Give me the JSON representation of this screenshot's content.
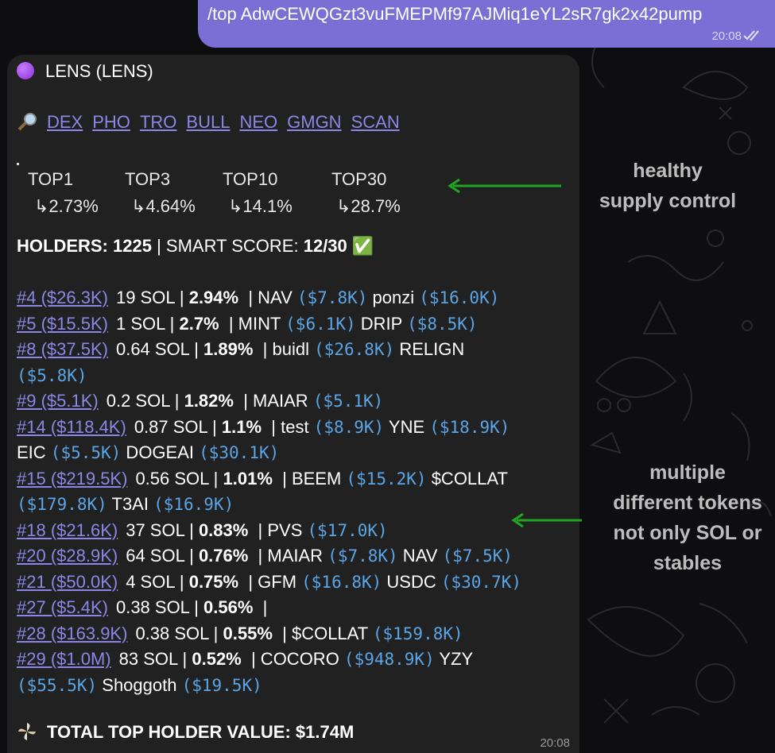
{
  "outgoing": {
    "text": "/top AdwCEWQGzt3vuFMEPMf97AJMiq1eYL2sR7gk2x42pump",
    "time": "20:08"
  },
  "message": {
    "title": "LENS (LENS)",
    "links": [
      "DEX",
      "PHO",
      "TRO",
      "BULL",
      "NEO",
      "GMGN",
      "SCAN"
    ],
    "top": [
      {
        "label": "TOP1",
        "value": "↳2.73%"
      },
      {
        "label": "TOP3",
        "value": "↳4.64%"
      },
      {
        "label": "TOP10",
        "value": "↳14.1%"
      },
      {
        "label": "TOP30",
        "value": "↳28.7%"
      }
    ],
    "holders_label": "HOLDERS:",
    "holders_value": "1225",
    "smart_label": "SMART SCORE:",
    "smart_value": "12/30",
    "check": "✅",
    "rows": [
      [
        {
          "t": "rank",
          "v": "#4 ($26.3K)"
        },
        {
          "t": "txt",
          "v": "19 SOL | "
        },
        {
          "t": "b",
          "v": "2.94%"
        },
        {
          "t": "txt",
          "v": "  | NAV "
        },
        {
          "t": "m",
          "v": "($7.8K)"
        },
        {
          "t": "txt",
          "v": " ponzi "
        },
        {
          "t": "m",
          "v": "($16.0K)"
        }
      ],
      [
        {
          "t": "rank",
          "v": "#5 ($15.5K)"
        },
        {
          "t": "txt",
          "v": "1 SOL | "
        },
        {
          "t": "b",
          "v": "2.7%"
        },
        {
          "t": "txt",
          "v": "  | MINT "
        },
        {
          "t": "m",
          "v": "($6.1K)"
        },
        {
          "t": "txt",
          "v": " DRIP "
        },
        {
          "t": "m",
          "v": "($8.5K)"
        }
      ],
      [
        {
          "t": "rank",
          "v": "#8 ($37.5K)"
        },
        {
          "t": "txt",
          "v": "0.64 SOL | "
        },
        {
          "t": "b",
          "v": "1.89%"
        },
        {
          "t": "txt",
          "v": "  | buidl "
        },
        {
          "t": "m",
          "v": "($26.8K)"
        },
        {
          "t": "txt",
          "v": " RELIGN"
        }
      ],
      [
        {
          "t": "m",
          "v": "($5.8K)"
        }
      ],
      [
        {
          "t": "rank",
          "v": "#9 ($5.1K)"
        },
        {
          "t": "txt",
          "v": "0.2 SOL | "
        },
        {
          "t": "b",
          "v": "1.82%"
        },
        {
          "t": "txt",
          "v": "  | MAIAR "
        },
        {
          "t": "m",
          "v": "($5.1K)"
        }
      ],
      [
        {
          "t": "rank",
          "v": "#14 ($118.4K)"
        },
        {
          "t": "txt",
          "v": "0.87 SOL | "
        },
        {
          "t": "b",
          "v": "1.1%"
        },
        {
          "t": "txt",
          "v": "  | test "
        },
        {
          "t": "m",
          "v": "($8.9K)"
        },
        {
          "t": "txt",
          "v": " YNE "
        },
        {
          "t": "m",
          "v": "($18.9K)"
        }
      ],
      [
        {
          "t": "txt",
          "v": "EIC "
        },
        {
          "t": "m",
          "v": "($5.5K)"
        },
        {
          "t": "txt",
          "v": " DOGEAI "
        },
        {
          "t": "m",
          "v": "($30.1K)"
        }
      ],
      [
        {
          "t": "rank",
          "v": "#15 ($219.5K)"
        },
        {
          "t": "txt",
          "v": "0.56 SOL | "
        },
        {
          "t": "b",
          "v": "1.01%"
        },
        {
          "t": "txt",
          "v": "  | BEEM "
        },
        {
          "t": "m",
          "v": "($15.2K)"
        },
        {
          "t": "txt",
          "v": " $COLLAT"
        }
      ],
      [
        {
          "t": "m",
          "v": "($179.8K)"
        },
        {
          "t": "txt",
          "v": " T3AI "
        },
        {
          "t": "m",
          "v": "($16.9K)"
        }
      ],
      [
        {
          "t": "rank",
          "v": "#18 ($21.6K)"
        },
        {
          "t": "txt",
          "v": "37 SOL | "
        },
        {
          "t": "b",
          "v": "0.83%"
        },
        {
          "t": "txt",
          "v": "  | PVS "
        },
        {
          "t": "m",
          "v": "($17.0K)"
        }
      ],
      [
        {
          "t": "rank",
          "v": "#20 ($28.9K)"
        },
        {
          "t": "txt",
          "v": "64 SOL | "
        },
        {
          "t": "b",
          "v": "0.76%"
        },
        {
          "t": "txt",
          "v": "  | MAIAR "
        },
        {
          "t": "m",
          "v": "($7.8K)"
        },
        {
          "t": "txt",
          "v": " NAV "
        },
        {
          "t": "m",
          "v": "($7.5K)"
        }
      ],
      [
        {
          "t": "rank",
          "v": "#21 ($50.0K)"
        },
        {
          "t": "txt",
          "v": "4 SOL | "
        },
        {
          "t": "b",
          "v": "0.75%"
        },
        {
          "t": "txt",
          "v": "  | GFM "
        },
        {
          "t": "m",
          "v": "($16.8K)"
        },
        {
          "t": "txt",
          "v": " USDC "
        },
        {
          "t": "m",
          "v": "($30.7K)"
        }
      ],
      [
        {
          "t": "rank",
          "v": "#27 ($5.4K)"
        },
        {
          "t": "txt",
          "v": "0.38 SOL | "
        },
        {
          "t": "b",
          "v": "0.56%"
        },
        {
          "t": "txt",
          "v": "  |"
        }
      ],
      [
        {
          "t": "rank",
          "v": "#28 ($163.9K)"
        },
        {
          "t": "txt",
          "v": "0.38 SOL | "
        },
        {
          "t": "b",
          "v": "0.55%"
        },
        {
          "t": "txt",
          "v": "  | $COLLAT "
        },
        {
          "t": "m",
          "v": "($159.8K)"
        }
      ],
      [
        {
          "t": "rank",
          "v": "#29 ($1.0M)"
        },
        {
          "t": "txt",
          "v": "83 SOL | "
        },
        {
          "t": "b",
          "v": "0.52%"
        },
        {
          "t": "txt",
          "v": "  | COCORO "
        },
        {
          "t": "m",
          "v": "($948.9K)"
        },
        {
          "t": "txt",
          "v": " YZY"
        }
      ],
      [
        {
          "t": "m",
          "v": "($55.5K)"
        },
        {
          "t": "txt",
          "v": " Shoggoth "
        },
        {
          "t": "m",
          "v": "($19.5K)"
        }
      ]
    ],
    "total": "TOTAL TOP HOLDER VALUE: $1.74M",
    "time": "20:08"
  },
  "annotations": {
    "a1_line1": "healthy",
    "a1_line2": "supply control",
    "a2_line1": "multiple",
    "a2_line2": "different tokens",
    "a2_line3": "not only SOL or",
    "a2_line4": "stables",
    "arrow_color": "#1fa51f"
  }
}
